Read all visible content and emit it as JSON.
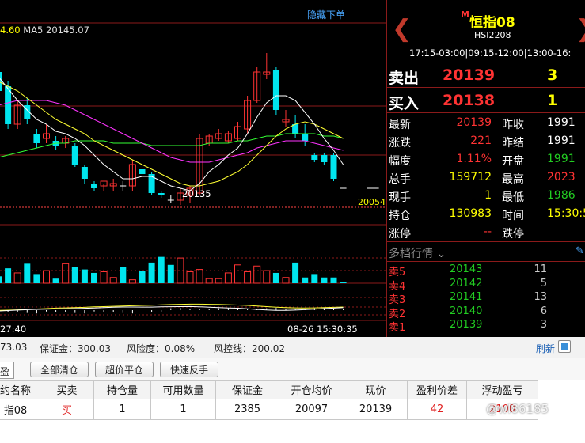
{
  "chart": {
    "hide_order_label": "隐藏下单",
    "ma_legend_prefix": "",
    "ma_legend_value": "4.60",
    "ma5_label": "MA5 20145.07",
    "low_label": "20135",
    "axis_price_label": "20054",
    "time_left": "27:40",
    "time_right": "08-26 15:30:35",
    "colors": {
      "up": "#ff3333",
      "down": "#00e5ee",
      "ma_white": "#ffffff",
      "ma_yellow": "#ffff33",
      "ma_magenta": "#ff33ff",
      "ma_green": "#33ff33"
    }
  },
  "chart_data": {
    "type": "candlestick",
    "candles": [
      {
        "o": 20188,
        "c": 20180,
        "h": 20190,
        "l": 20178
      },
      {
        "o": 20182,
        "c": 20166,
        "h": 20184,
        "l": 20164
      },
      {
        "o": 20166,
        "c": 20174,
        "h": 20176,
        "l": 20164
      },
      {
        "o": 20174,
        "c": 20168,
        "h": 20177,
        "l": 20166
      },
      {
        "o": 20162,
        "c": 20158,
        "h": 20164,
        "l": 20156
      },
      {
        "o": 20160,
        "c": 20162,
        "h": 20166,
        "l": 20158
      },
      {
        "o": 20159,
        "c": 20157,
        "h": 20161,
        "l": 20155
      },
      {
        "o": 20158,
        "c": 20160,
        "h": 20161,
        "l": 20156
      },
      {
        "o": 20157,
        "c": 20149,
        "h": 20158,
        "l": 20148
      },
      {
        "o": 20148,
        "c": 20143,
        "h": 20149,
        "l": 20141
      },
      {
        "o": 20141,
        "c": 20139,
        "h": 20142,
        "l": 20138
      },
      {
        "o": 20140,
        "c": 20142,
        "h": 20141,
        "l": 20138
      },
      {
        "o": 20140,
        "c": 20141,
        "h": 20143,
        "l": 20138
      },
      {
        "o": 20140,
        "c": 20140,
        "h": 20142,
        "l": 20138
      },
      {
        "o": 20140,
        "c": 20149,
        "h": 20151,
        "l": 20138
      },
      {
        "o": 20147,
        "c": 20145,
        "h": 20148,
        "l": 20143
      },
      {
        "o": 20145,
        "c": 20137,
        "h": 20146,
        "l": 20136
      },
      {
        "o": 20137,
        "c": 20136,
        "h": 20138,
        "l": 20135
      },
      {
        "o": 20134,
        "c": 20134,
        "h": 20136,
        "l": 20133
      },
      {
        "o": 20134,
        "c": 20137,
        "h": 20139,
        "l": 20132
      },
      {
        "o": 20136,
        "c": 20139,
        "h": 20140,
        "l": 20133
      },
      {
        "o": 20137,
        "c": 20160,
        "h": 20162,
        "l": 20136
      },
      {
        "o": 20158,
        "c": 20161,
        "h": 20162,
        "l": 20157
      },
      {
        "o": 20160,
        "c": 20162,
        "h": 20164,
        "l": 20159
      },
      {
        "o": 20159,
        "c": 20162,
        "h": 20163,
        "l": 20158
      },
      {
        "o": 20160,
        "c": 20165,
        "h": 20167,
        "l": 20159
      },
      {
        "o": 20164,
        "c": 20176,
        "h": 20178,
        "l": 20162
      },
      {
        "o": 20176,
        "c": 20188,
        "h": 20190,
        "l": 20175
      },
      {
        "o": 20187,
        "c": 20188,
        "h": 20196,
        "l": 20185
      },
      {
        "o": 20189,
        "c": 20172,
        "h": 20190,
        "l": 20170
      },
      {
        "o": 20167,
        "c": 20168,
        "h": 20172,
        "l": 20165
      },
      {
        "o": 20166,
        "c": 20162,
        "h": 20170,
        "l": 20160
      },
      {
        "o": 20162,
        "c": 20159,
        "h": 20166,
        "l": 20157
      },
      {
        "o": 20153,
        "c": 20151,
        "h": 20154,
        "l": 20150
      },
      {
        "o": 20153,
        "c": 20150,
        "h": 20154,
        "l": 20149
      },
      {
        "o": 20153,
        "c": 20143,
        "h": 20154,
        "l": 20142
      },
      {
        "o": 20139,
        "c": 20139,
        "h": 20139,
        "l": 20139
      }
    ],
    "volumes": [
      6,
      13,
      9,
      17,
      8,
      11,
      4,
      17,
      14,
      12,
      9,
      10,
      5,
      14,
      3,
      11,
      18,
      23,
      16,
      22,
      10,
      12,
      4,
      4,
      9,
      16,
      10,
      15,
      11,
      9,
      5,
      18,
      5,
      8,
      5,
      5,
      1
    ],
    "ma_white": [
      20186,
      20181,
      20176,
      20172,
      20168,
      20166,
      20163,
      20162,
      20160,
      20157,
      20153,
      20149,
      20146,
      20143,
      20143,
      20144,
      20144,
      20142,
      20140,
      20139,
      20138,
      20141,
      20146,
      20149,
      20153,
      20156,
      20162,
      20169,
      20175,
      20178,
      20178,
      20176,
      20171,
      20166,
      20160,
      20155,
      20149
    ],
    "ma_yellow": [
      20184,
      20182,
      20180,
      20177,
      20174,
      20171,
      20168,
      20166,
      20164,
      20162,
      20159,
      20157,
      20155,
      20153,
      20151,
      20149,
      20147,
      20145,
      20143,
      20141,
      20140,
      20140,
      20141,
      20142,
      20144,
      20146,
      20149,
      20153,
      20157,
      20161,
      20164,
      20166,
      20167,
      20166,
      20164,
      20162,
      20160
    ],
    "ma_magenta": [
      20174,
      20175,
      20176,
      20176,
      20176,
      20176,
      20175,
      20174,
      20172,
      20170,
      20168,
      20166,
      20164,
      20162,
      20160,
      20158,
      20156,
      20154,
      20152,
      20151,
      20150,
      20150,
      20150,
      20151,
      20152,
      20153,
      20154,
      20156,
      20157,
      20158,
      20159,
      20159,
      20159,
      20158,
      20157,
      20156,
      20155
    ],
    "ma_green": [
      20152,
      20153,
      20154,
      20155,
      20156,
      20157,
      20158,
      20158,
      20159,
      20159,
      20159,
      20159,
      20158,
      20158,
      20158,
      20158,
      20157,
      20157,
      20157,
      20157,
      20157,
      20157,
      20158,
      20158,
      20158,
      20159,
      20159,
      20160,
      20161,
      20161,
      20162,
      20162,
      20162,
      20162,
      20161,
      20161,
      20160
    ],
    "ylim": [
      20125,
      20205
    ]
  },
  "quote": {
    "contract_mark": "M",
    "contract_name": "恒指08",
    "contract_code": "HSI2208",
    "sessions": "17:15-03:00|09:15-12:00|13:00-16:",
    "ask_label": "卖出",
    "ask_price": "20139",
    "ask_qty": "3",
    "bid_label": "买入",
    "bid_price": "20138",
    "bid_qty": "1",
    "stats": [
      {
        "l1": "最新",
        "v1": "20139",
        "c1": "#ff3333",
        "l2": "昨收",
        "v2": "1991"
      },
      {
        "l1": "涨跌",
        "v1": "221",
        "c1": "#ff3333",
        "l2": "昨结",
        "v2": "1991"
      },
      {
        "l1": "幅度",
        "v1": "1.11%",
        "c1": "#ff3333",
        "l2": "开盘",
        "v2": "1991"
      },
      {
        "l1": "总手",
        "v1": "159712",
        "c1": "#ffff00",
        "l2": "最高",
        "v2": "2023"
      },
      {
        "l1": "现手",
        "v1": "1",
        "c1": "#ffff00",
        "l2": "最低",
        "v2": "1986"
      },
      {
        "l1": "持仓",
        "v1": "130983",
        "c1": "#ffff00",
        "l2": "时间",
        "v2": "15:30:5"
      },
      {
        "l1": "涨停",
        "v1": "--",
        "c1": "#ff3333",
        "l2": "跌停",
        "v2": ""
      }
    ],
    "stat_colors2": [
      "#ffffff",
      "#ffffff",
      "#22cc22",
      "#ff3333",
      "#22cc22",
      "#ffff00",
      "#ffffff"
    ],
    "depth_title": "多档行情",
    "depth": [
      {
        "label": "卖5",
        "price": "20143",
        "qty": "11"
      },
      {
        "label": "卖4",
        "price": "20142",
        "qty": "5"
      },
      {
        "label": "卖3",
        "price": "20141",
        "qty": "13"
      },
      {
        "label": "卖2",
        "price": "20140",
        "qty": "6"
      },
      {
        "label": "卖1",
        "price": "20139",
        "qty": "3"
      }
    ]
  },
  "status": {
    "equity_partial": "73.03",
    "margin": "保证金：300.03",
    "risk": "风险度：0.08%",
    "risk_line": "风控线：200.02",
    "refresh": "刷新"
  },
  "toolbar": {
    "tab_stub": "盈",
    "close_all": "全部清仓",
    "super_close": "超价平仓",
    "quick_reverse": "快速反手"
  },
  "positions": {
    "headers": [
      "约名称",
      "买卖",
      "持仓量",
      "可用数量",
      "保证金",
      "开仓均价",
      "现价",
      "盈利价差",
      "浮动盈亏"
    ],
    "rows": [
      [
        "指08",
        "买",
        "1",
        "1",
        "2385",
        "20097",
        "20139",
        "42",
        "2100"
      ]
    ]
  },
  "watermark": "@wl86185"
}
